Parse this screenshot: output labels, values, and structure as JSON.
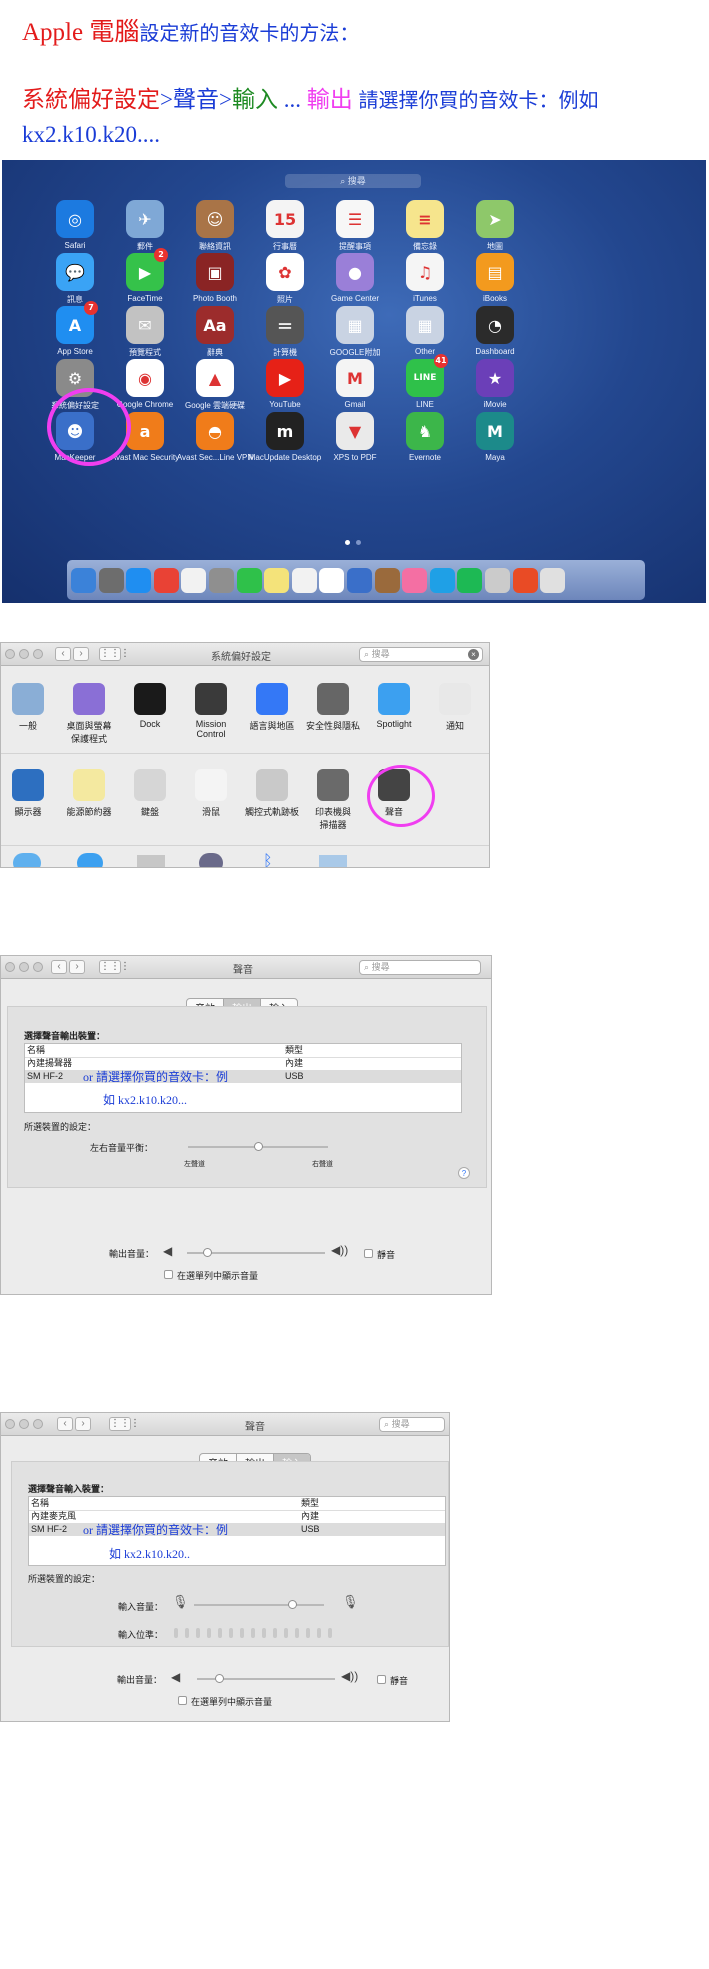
{
  "heading": {
    "brand": "Apple",
    "computer": "電腦",
    "rest": "設定新的音效卡的方法："
  },
  "path": {
    "sysprefs": "系統偏好設定",
    "sep1": ">",
    "sound": "聲音",
    "sep2": ">",
    "input": "輸入",
    "dots": "...",
    "output": "輸出",
    "instruction": "請選擇你買的音效卡：例如",
    "examples": "kx2.k10.k20...."
  },
  "launchpad": {
    "search_placeholder": "搜尋",
    "apps": [
      {
        "label": "Safari",
        "icon": "safari-icon",
        "color": "#1c7ae0",
        "glyph": "◎"
      },
      {
        "label": "郵件",
        "icon": "mail-icon",
        "color": "#7fa8d6",
        "glyph": "✈"
      },
      {
        "label": "聯絡資訊",
        "icon": "contacts-icon",
        "color": "#a97447",
        "glyph": "☺"
      },
      {
        "label": "行事曆",
        "icon": "calendar-icon",
        "color": "#f4f4f4",
        "glyph": "15"
      },
      {
        "label": "提醒事項",
        "icon": "reminders-icon",
        "color": "#f7f7f7",
        "glyph": "☰"
      },
      {
        "label": "備忘錄",
        "icon": "notes-icon",
        "color": "#f6e58d",
        "glyph": "≡"
      },
      {
        "label": "地圖",
        "icon": "maps-icon",
        "color": "#8ec86a",
        "glyph": "➤"
      },
      {
        "label": "訊息",
        "icon": "messages-icon",
        "color": "#3aa3f5",
        "glyph": "💬"
      },
      {
        "label": "FaceTime",
        "icon": "facetime-icon",
        "color": "#35c24a",
        "glyph": "▶",
        "badge": "2"
      },
      {
        "label": "Photo Booth",
        "icon": "photo-booth-icon",
        "color": "#8a2424",
        "glyph": "▣"
      },
      {
        "label": "照片",
        "icon": "photos-icon",
        "color": "#ffffff",
        "glyph": "✿"
      },
      {
        "label": "Game Center",
        "icon": "game-center-icon",
        "color": "#9a7fd8",
        "glyph": "●"
      },
      {
        "label": "iTunes",
        "icon": "itunes-icon",
        "color": "#f5f5f5",
        "glyph": "♫"
      },
      {
        "label": "iBooks",
        "icon": "ibooks-icon",
        "color": "#f39a1e",
        "glyph": "▤"
      },
      {
        "label": "App Store",
        "icon": "app-store-icon",
        "color": "#1f8ef1",
        "glyph": "A",
        "badge": "7"
      },
      {
        "label": "預覽程式",
        "icon": "preview-icon",
        "color": "#c2c2c2",
        "glyph": "✉"
      },
      {
        "label": "辭典",
        "icon": "dictionary-icon",
        "color": "#9c2c2c",
        "glyph": "Aa"
      },
      {
        "label": "計算機",
        "icon": "calculator-icon",
        "color": "#555555",
        "glyph": "＝"
      },
      {
        "label": "GOOGLE附加",
        "icon": "folder-icon",
        "color": "#c9d3e3",
        "glyph": "▦"
      },
      {
        "label": "Other",
        "icon": "folder-other-icon",
        "color": "#c9d3e3",
        "glyph": "▦"
      },
      {
        "label": "Dashboard",
        "icon": "dashboard-icon",
        "color": "#2b2b2b",
        "glyph": "◔"
      },
      {
        "label": "系統偏好設定",
        "icon": "system-preferences-icon",
        "color": "#8a8a8a",
        "glyph": "⚙"
      },
      {
        "label": "Google Chrome",
        "icon": "chrome-icon",
        "color": "#ffffff",
        "glyph": "◉"
      },
      {
        "label": "Google 雲端硬碟",
        "icon": "google-drive-icon",
        "color": "#ffffff",
        "glyph": "▲"
      },
      {
        "label": "YouTube",
        "icon": "youtube-icon",
        "color": "#e62117",
        "glyph": "▶"
      },
      {
        "label": "Gmail",
        "icon": "gmail-icon",
        "color": "#f4f4f4",
        "glyph": "M"
      },
      {
        "label": "LINE",
        "icon": "line-icon",
        "color": "#2fc14a",
        "glyph": "LINE",
        "badge": "41"
      },
      {
        "label": "iMovie",
        "icon": "imovie-icon",
        "color": "#6b3fb8",
        "glyph": "★"
      },
      {
        "label": "MacKeeper",
        "icon": "mackeeper-icon",
        "color": "#3a6fc9",
        "glyph": "☻"
      },
      {
        "label": "Avast Mac Security",
        "icon": "avast-icon",
        "color": "#f07c1a",
        "glyph": "a"
      },
      {
        "label": "Avast Sec...Line VPN",
        "icon": "avast-vpn-icon",
        "color": "#f07c1a",
        "glyph": "◓"
      },
      {
        "label": "MacUpdate Desktop",
        "icon": "macupdate-icon",
        "color": "#222222",
        "glyph": "m"
      },
      {
        "label": "XPS to PDF",
        "icon": "xps-to-pdf-icon",
        "color": "#eaeaea",
        "glyph": "▼"
      },
      {
        "label": "Evernote",
        "icon": "evernote-icon",
        "color": "#3cb64a",
        "glyph": "♞"
      },
      {
        "label": "Maya",
        "icon": "maya-icon",
        "color": "#1c8a8a",
        "glyph": "M"
      }
    ],
    "dock": [
      "#3b82d9",
      "#6d6d6d",
      "#1f8ef1",
      "#e94235",
      "#f2f2f2",
      "#8f8f8f",
      "#2fc14a",
      "#f4e37a",
      "#f2f2f2",
      "#ffffff",
      "#3a6fc9",
      "#9a6a3c",
      "#f46fa3",
      "#1fa0e6",
      "#1db954",
      "#cbcbcb",
      "#e94b25",
      "#e0e0e0"
    ]
  },
  "sysprefs": {
    "title": "系統偏好設定",
    "search_placeholder": "搜尋",
    "row1": [
      {
        "label": "一般",
        "icon": "general-icon",
        "color": "#8aaed6"
      },
      {
        "label": "桌面與螢幕\n保護程式",
        "icon": "desktop-icon",
        "color": "#8a6fd6"
      },
      {
        "label": "Dock",
        "icon": "dock-icon",
        "color": "#1a1a1a"
      },
      {
        "label": "Mission\nControl",
        "icon": "mission-control-icon",
        "color": "#3a3a3a"
      },
      {
        "label": "語言與地區",
        "icon": "language-icon",
        "color": "#3478f6"
      },
      {
        "label": "安全性與隱私",
        "icon": "security-icon",
        "color": "#666666"
      },
      {
        "label": "Spotlight",
        "icon": "spotlight-icon",
        "color": "#3ca0f0"
      },
      {
        "label": "通知",
        "icon": "notifications-icon",
        "color": "#e8e8e8"
      }
    ],
    "row2": [
      {
        "label": "顯示器",
        "icon": "displays-icon",
        "color": "#2d6fc0"
      },
      {
        "label": "能源節約器",
        "icon": "energy-icon",
        "color": "#f4e9a0"
      },
      {
        "label": "鍵盤",
        "icon": "keyboard-icon",
        "color": "#d6d6d6"
      },
      {
        "label": "滑鼠",
        "icon": "mouse-icon",
        "color": "#f4f4f4"
      },
      {
        "label": "觸控式軌跡板",
        "icon": "trackpad-icon",
        "color": "#c9c9c9"
      },
      {
        "label": "印表機與\n掃描器",
        "icon": "printer-icon",
        "color": "#6a6a6a"
      },
      {
        "label": "聲音",
        "icon": "sound-icon",
        "color": "#444444"
      }
    ]
  },
  "output_panel": {
    "title": "聲音",
    "search_placeholder": "搜尋",
    "tabs": [
      "音效",
      "輸出",
      "輸入"
    ],
    "section": "選擇聲音輸出裝置：",
    "col_name": "名稱",
    "col_type": "類型",
    "rows": [
      {
        "name": "內建揚聲器",
        "type": "內建"
      },
      {
        "name": "SM HF-2",
        "type": "USB"
      }
    ],
    "note1": "or 請選擇你買的音效卡：例",
    "note2": "如 kx2.k10.k20...",
    "device_settings": "所選裝置的設定：",
    "balance": "左右音量平衡：",
    "left": "左聲道",
    "right": "右聲道",
    "help": "?",
    "volume": "輸出音量：",
    "mute": "靜音",
    "show_in_menu": "在選單列中顯示音量"
  },
  "input_panel": {
    "title": "聲音",
    "search_placeholder": "搜尋",
    "tabs": [
      "音效",
      "輸出",
      "輸入"
    ],
    "section": "選擇聲音輸入裝置：",
    "col_name": "名稱",
    "col_type": "類型",
    "rows": [
      {
        "name": "內建麥克風",
        "type": "內建"
      },
      {
        "name": "SM HF-2",
        "type": "USB"
      }
    ],
    "note1": "or 請選擇你買的音效卡：例",
    "note2": "如 kx2.k10.k20..",
    "device_settings": "所選裝置的設定：",
    "input_volume": "輸入音量：",
    "input_level": "輸入位準：",
    "volume": "輸出音量：",
    "mute": "靜音",
    "show_in_menu": "在選單列中顯示音量"
  }
}
